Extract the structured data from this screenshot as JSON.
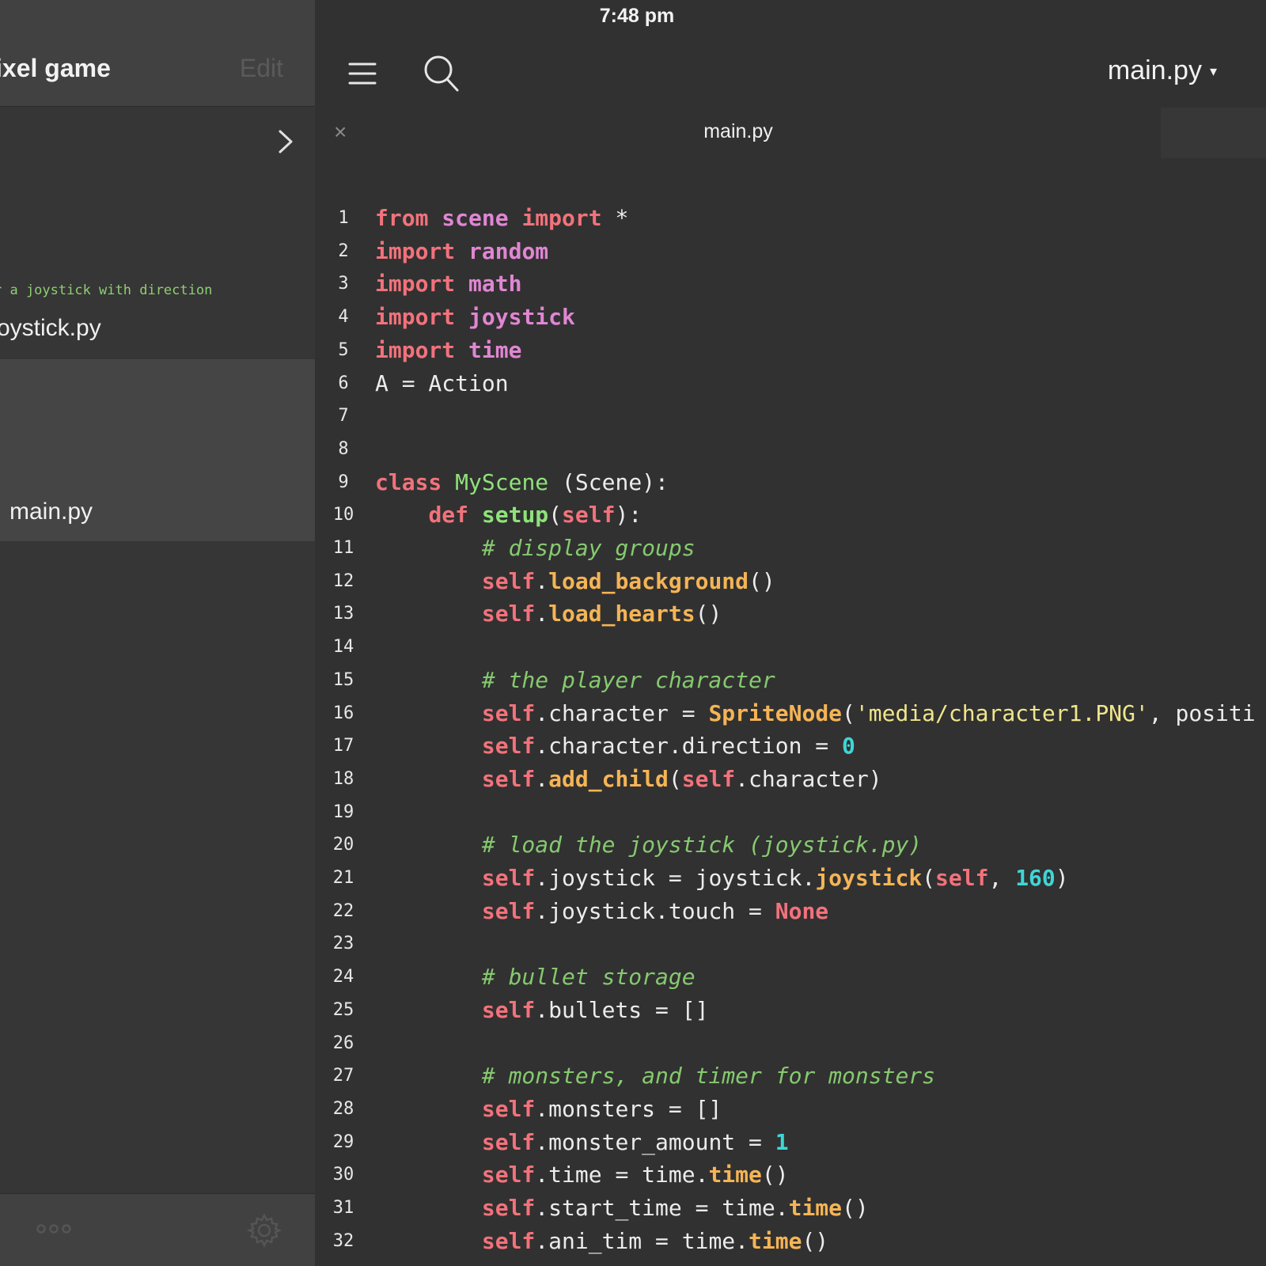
{
  "status_bar": {
    "time": "7:48 pm"
  },
  "sidebar": {
    "title": "ixel game",
    "edit_label": "Edit",
    "description": "r a joystick with direction",
    "files": [
      "oystick.py",
      "main.py"
    ]
  },
  "toolbar": {
    "file_title": "main.py",
    "caret": "▾"
  },
  "tab": {
    "close": "×",
    "label": "main.py"
  },
  "colors": {
    "keyword": "#f2727b",
    "module": "#e086d3",
    "class_name": "#8fe27a",
    "method": "#f5b455",
    "string": "#f0e68c",
    "number": "#3fd6d6",
    "comment": "#86c96f"
  },
  "code_lines": [
    [
      [
        "kw",
        "from"
      ],
      [
        "plain",
        " "
      ],
      [
        "mod",
        "scene"
      ],
      [
        "plain",
        " "
      ],
      [
        "kw",
        "import"
      ],
      [
        "plain",
        " *"
      ]
    ],
    [
      [
        "kw",
        "import"
      ],
      [
        "plain",
        " "
      ],
      [
        "mod",
        "random"
      ]
    ],
    [
      [
        "kw",
        "import"
      ],
      [
        "plain",
        " "
      ],
      [
        "mod",
        "math"
      ]
    ],
    [
      [
        "kw",
        "import"
      ],
      [
        "plain",
        " "
      ],
      [
        "mod",
        "joystick"
      ]
    ],
    [
      [
        "kw",
        "import"
      ],
      [
        "plain",
        " "
      ],
      [
        "mod",
        "time"
      ]
    ],
    [
      [
        "plain",
        "A = Action"
      ]
    ],
    [],
    [],
    [
      [
        "kw",
        "class"
      ],
      [
        "plain",
        " "
      ],
      [
        "cls",
        "MyScene"
      ],
      [
        "plain",
        " (Scene):"
      ]
    ],
    [
      [
        "plain",
        "    "
      ],
      [
        "kw",
        "def"
      ],
      [
        "plain",
        " "
      ],
      [
        "fn",
        "setup"
      ],
      [
        "plain",
        "("
      ],
      [
        "self",
        "self"
      ],
      [
        "plain",
        "):"
      ]
    ],
    [
      [
        "plain",
        "        "
      ],
      [
        "com",
        "# display groups"
      ]
    ],
    [
      [
        "plain",
        "        "
      ],
      [
        "self",
        "self"
      ],
      [
        "plain",
        "."
      ],
      [
        "meth",
        "load_background"
      ],
      [
        "plain",
        "()"
      ]
    ],
    [
      [
        "plain",
        "        "
      ],
      [
        "self",
        "self"
      ],
      [
        "plain",
        "."
      ],
      [
        "meth",
        "load_hearts"
      ],
      [
        "plain",
        "()"
      ]
    ],
    [],
    [
      [
        "plain",
        "        "
      ],
      [
        "com",
        "# the player character"
      ]
    ],
    [
      [
        "plain",
        "        "
      ],
      [
        "self",
        "self"
      ],
      [
        "plain",
        ".character = "
      ],
      [
        "meth",
        "SpriteNode"
      ],
      [
        "plain",
        "("
      ],
      [
        "str",
        "'media/character1.PNG'"
      ],
      [
        "plain",
        ", positi"
      ]
    ],
    [
      [
        "plain",
        "        "
      ],
      [
        "self",
        "self"
      ],
      [
        "plain",
        ".character.direction = "
      ],
      [
        "num",
        "0"
      ]
    ],
    [
      [
        "plain",
        "        "
      ],
      [
        "self",
        "self"
      ],
      [
        "plain",
        "."
      ],
      [
        "meth",
        "add_child"
      ],
      [
        "plain",
        "("
      ],
      [
        "self",
        "self"
      ],
      [
        "plain",
        ".character)"
      ]
    ],
    [],
    [
      [
        "plain",
        "        "
      ],
      [
        "com",
        "# load the joystick (joystick.py)"
      ]
    ],
    [
      [
        "plain",
        "        "
      ],
      [
        "self",
        "self"
      ],
      [
        "plain",
        ".joystick = joystick."
      ],
      [
        "meth",
        "joystick"
      ],
      [
        "plain",
        "("
      ],
      [
        "self",
        "self"
      ],
      [
        "plain",
        ", "
      ],
      [
        "num",
        "160"
      ],
      [
        "plain",
        ")"
      ]
    ],
    [
      [
        "plain",
        "        "
      ],
      [
        "self",
        "self"
      ],
      [
        "plain",
        ".joystick.touch = "
      ],
      [
        "kw",
        "None"
      ]
    ],
    [],
    [
      [
        "plain",
        "        "
      ],
      [
        "com",
        "# bullet storage"
      ]
    ],
    [
      [
        "plain",
        "        "
      ],
      [
        "self",
        "self"
      ],
      [
        "plain",
        ".bullets = []"
      ]
    ],
    [],
    [
      [
        "plain",
        "        "
      ],
      [
        "com",
        "# monsters, and timer for monsters"
      ]
    ],
    [
      [
        "plain",
        "        "
      ],
      [
        "self",
        "self"
      ],
      [
        "plain",
        ".monsters = []"
      ]
    ],
    [
      [
        "plain",
        "        "
      ],
      [
        "self",
        "self"
      ],
      [
        "plain",
        ".monster_amount = "
      ],
      [
        "num",
        "1"
      ]
    ],
    [
      [
        "plain",
        "        "
      ],
      [
        "self",
        "self"
      ],
      [
        "plain",
        ".time = time."
      ],
      [
        "meth",
        "time"
      ],
      [
        "plain",
        "()"
      ]
    ],
    [
      [
        "plain",
        "        "
      ],
      [
        "self",
        "self"
      ],
      [
        "plain",
        ".start_time = time."
      ],
      [
        "meth",
        "time"
      ],
      [
        "plain",
        "()"
      ]
    ],
    [
      [
        "plain",
        "        "
      ],
      [
        "self",
        "self"
      ],
      [
        "plain",
        ".ani_tim = time."
      ],
      [
        "meth",
        "time"
      ],
      [
        "plain",
        "()"
      ]
    ]
  ]
}
